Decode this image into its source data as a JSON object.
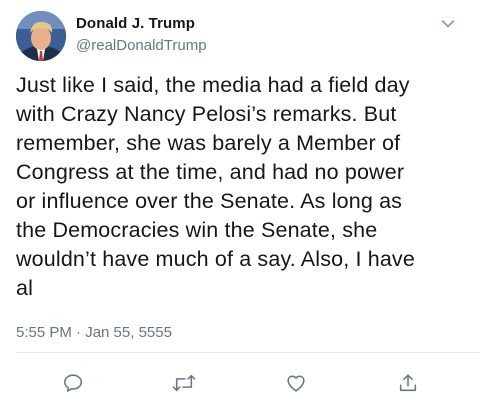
{
  "author": {
    "display_name": "Donald J. Trump",
    "handle": "@realDonaldTrump"
  },
  "tweet": {
    "text": "Just like I said, the media had a field day\nwith Crazy Nancy Pelosi’s remarks. But\nremember, she was barely a Member of\nCongress at the time, and had no power\nor influence over the Senate. As long as\nthe Democracies win the Senate, she\nwouldn’t have much of a say. Also, I have\nal",
    "timestamp": "5:55 PM · Jan 55, 5555"
  },
  "icons": {
    "menu": "chevron-down-icon",
    "reply": "reply-icon",
    "retweet": "retweet-icon",
    "like": "heart-icon",
    "share": "share-icon"
  },
  "colors": {
    "text": "#14171a",
    "secondary": "#657786",
    "divider": "#e6ecf0"
  }
}
